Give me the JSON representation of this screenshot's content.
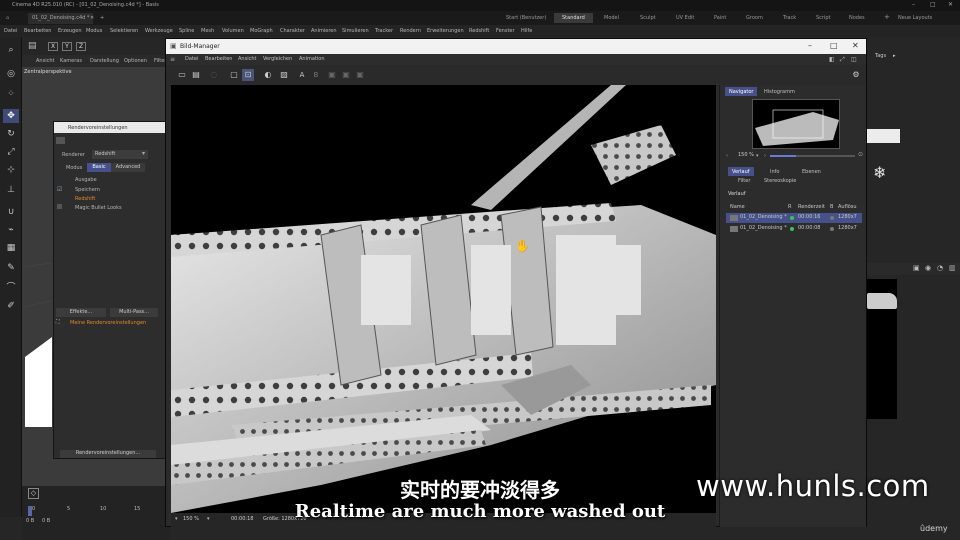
{
  "app": {
    "title": "Cinema 4D R25.010 (RC) - [01_02_Denoising.c4d *] - Basis",
    "doc_tab": "01_02_Denoising.c4d *",
    "layout_tabs": [
      "Start (Benutzer)",
      "Standard",
      "Model",
      "Sculpt",
      "UV Edit",
      "Paint",
      "Groom",
      "Track",
      "Script",
      "Nodes"
    ],
    "active_layout": "Standard",
    "new_layouts": "Neue Layouts"
  },
  "main_menu": [
    "Datei",
    "Bearbeiten",
    "Erzeugen",
    "Modus",
    "Selektieren",
    "Werkzeuge",
    "Spline",
    "Mesh",
    "Volumen",
    "MoGraph",
    "Charakter",
    "Animieren",
    "Simulieren",
    "Tracker",
    "Rendern",
    "Erweiterungen",
    "Redshift",
    "Fenster",
    "Hilfe"
  ],
  "viewport": {
    "menu": [
      "Ansicht",
      "Kameras",
      "Darstellung",
      "Optionen",
      "Filter"
    ],
    "label": "Zentralperspektive",
    "axes": [
      "X",
      "Y",
      "Z"
    ]
  },
  "render_settings": {
    "title": "Rendervoreinstellungen",
    "renderer_label": "Renderer",
    "renderer_value": "Redshift",
    "mode_label": "Modus",
    "mode_tabs": [
      "Basic",
      "Advanced"
    ],
    "items": [
      "Ausgabe",
      "Speichern",
      "Redshift",
      "Magic Bullet Looks"
    ],
    "effects_button": "Effekte...",
    "multipass_button": "Multi-Pass...",
    "preset": "Meine Rendervoreinstellungen",
    "footer_button": "Rendervoreinstellungen..."
  },
  "bild_manager": {
    "title": "Bild-Manager",
    "menu": [
      "Datei",
      "Bearbeiten",
      "Ansicht",
      "Vergleichen",
      "Animation"
    ],
    "status_zoom": "150 %",
    "status_time": "00:00:18",
    "status_size": "Größe: 1280x720",
    "panel_tabs": [
      "Navigator",
      "Histogramm"
    ],
    "zoom": "150 %",
    "info_tabs": [
      "Verlauf",
      "Info",
      "Ebenen"
    ],
    "sub_tabs": [
      "Filter",
      "Stereoskopie"
    ],
    "history_title": "Verlauf",
    "columns": [
      "Name",
      "R",
      "Renderzeit",
      "B",
      "Auflösu"
    ],
    "rows": [
      {
        "name": "01_02_Denoising *",
        "time": "00:00:16",
        "res": "1280x7"
      },
      {
        "name": "01_02_Denoising *",
        "time": "00:00:08",
        "res": "1280x7"
      }
    ]
  },
  "right_panel": {
    "tags_label": "Tags"
  },
  "timeline": {
    "ticks": [
      "0",
      "5",
      "10",
      "15"
    ],
    "frame_start": "0 B",
    "frame_current": "0 B"
  },
  "subtitles": {
    "cn": "实时的要冲淡得多",
    "en": "Realtime are much more washed out"
  },
  "watermark": "www.hunls.com",
  "udemy": "ûdemy",
  "colors": {
    "accent": "#46508a",
    "render_green": "#3fbf5a"
  }
}
